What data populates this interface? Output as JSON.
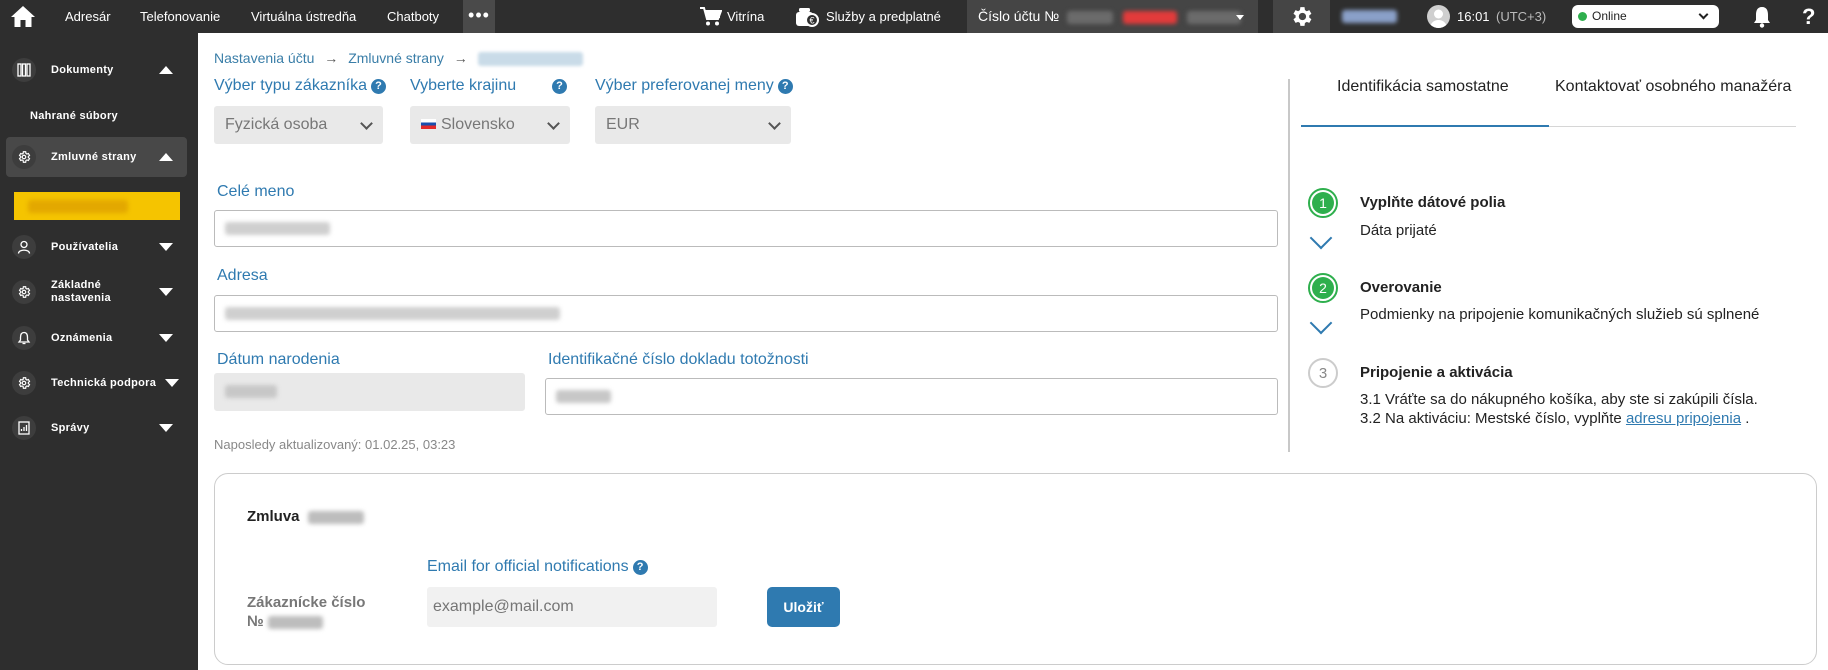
{
  "topbar": {
    "nav": [
      "Adresár",
      "Telefonovanie",
      "Virtuálna ústredňa",
      "Chatboty"
    ],
    "more": "•••",
    "showcase": "Vitrína",
    "services": "Služby a predplatné",
    "account_label": "Číslo účtu №",
    "time": "16:01",
    "timezone": "(UTC+3)",
    "status": "Online",
    "status_color": "#2eaf4d",
    "help": "?",
    "icons": [
      "home-icon",
      "cart-icon",
      "wallet-icon",
      "gear-icon",
      "user-icon",
      "bell-icon",
      "help-icon"
    ]
  },
  "sidebar": {
    "items": [
      {
        "label": "Dokumenty",
        "icon": "documents-icon",
        "expanded": true
      },
      {
        "label": "Nahrané súbory",
        "sub": true
      },
      {
        "label": "Zmluvné strany",
        "icon": "gear-icon",
        "expanded": true,
        "active": true
      },
      {
        "label": "Používatelia",
        "icon": "user-icon"
      },
      {
        "label": "Základné nastavenia",
        "icon": "gear-icon"
      },
      {
        "label": "Oznámenia",
        "icon": "bell-icon"
      },
      {
        "label": "Technická podpora",
        "icon": "gear-icon"
      },
      {
        "label": "Správy",
        "icon": "report-icon"
      }
    ],
    "highlight_color": "#f5c400"
  },
  "breadcrumb": [
    "Nastavenia účtu",
    "Zmluvné strany"
  ],
  "breadcrumb_sep": "→",
  "form": {
    "customer_type_label": "Výber typu zákazníka",
    "customer_type_value": "Fyzická osoba",
    "country_label": "Vyberte krajinu",
    "country_value": "Slovensko",
    "currency_label": "Výber preferovanej meny",
    "currency_value": "EUR",
    "full_name_label": "Celé meno",
    "address_label": "Adresa",
    "birth_date_label": "Dátum narodenia",
    "id_document_label": "Identifikačné číslo dokladu totožnosti",
    "last_updated": "Naposledy aktualizovaný: 01.02.25, 03:23"
  },
  "tabs": [
    "Identifikácia samostatne",
    "Kontaktovať osobného manažéra"
  ],
  "accent_color": "#2f7ab0",
  "steps": [
    {
      "num": "1",
      "title": "Vyplňte dátové polia",
      "text": "Dáta prijaté"
    },
    {
      "num": "2",
      "title": "Overovanie",
      "text": "Podmienky na pripojenie komunikačných služieb sú splnené"
    },
    {
      "num": "3",
      "title": "Pripojenie a aktivácia",
      "line1": "3.1 Vráťte sa do nákupného košíka, aby ste si zakúpili čísla.",
      "line2_prefix": "3.2 Na aktiváciu: Mestské číslo, vyplňte ",
      "line2_link": "adresu pripojenia",
      "line2_suffix": " ."
    }
  ],
  "contract": {
    "title": "Zmluva",
    "customer_number_label": "Zákaznícke číslo",
    "customer_number_prefix": "№",
    "email_label": "Email for official notifications",
    "email_placeholder": "example@mail.com",
    "save_label": "Uložiť"
  }
}
